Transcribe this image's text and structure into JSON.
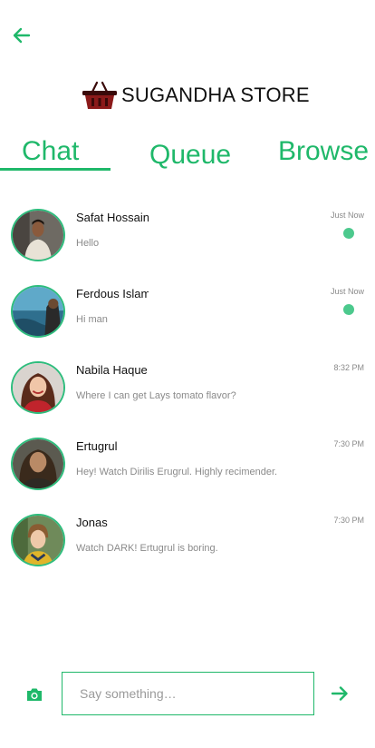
{
  "colors": {
    "accent": "#1fb86a",
    "unread": "#4cc98d",
    "muted": "#8a8a8a"
  },
  "header": {
    "back_icon": "arrow-left-icon"
  },
  "brand": {
    "logo_icon": "shopping-basket-icon",
    "name": "SUGANDHA STORE"
  },
  "tabs": [
    {
      "label": "Chat",
      "active": true
    },
    {
      "label": "Queue",
      "active": false
    },
    {
      "label": "Browse",
      "active": false
    }
  ],
  "chats": [
    {
      "name": "Safat Hossain",
      "preview": "Hello",
      "time": "Just Now",
      "unread": true
    },
    {
      "name": "Ferdous Islam",
      "preview": "Hi man",
      "time": "Just Now",
      "unread": true
    },
    {
      "name": "Nabila Haque",
      "preview": "Where I can get Lays tomato flavor?",
      "time": "8:32 PM",
      "unread": false
    },
    {
      "name": "Ertugrul",
      "preview": "Hey! Watch Dirilis Erugrul. Highly recimender.",
      "time": "7:30 PM",
      "unread": false
    },
    {
      "name": "Jonas",
      "preview": "Watch DARK! Ertugrul is boring.",
      "time": "7:30 PM",
      "unread": false
    }
  ],
  "composer": {
    "camera_icon": "camera-icon",
    "placeholder": "Say something…",
    "send_icon": "arrow-right-icon"
  }
}
